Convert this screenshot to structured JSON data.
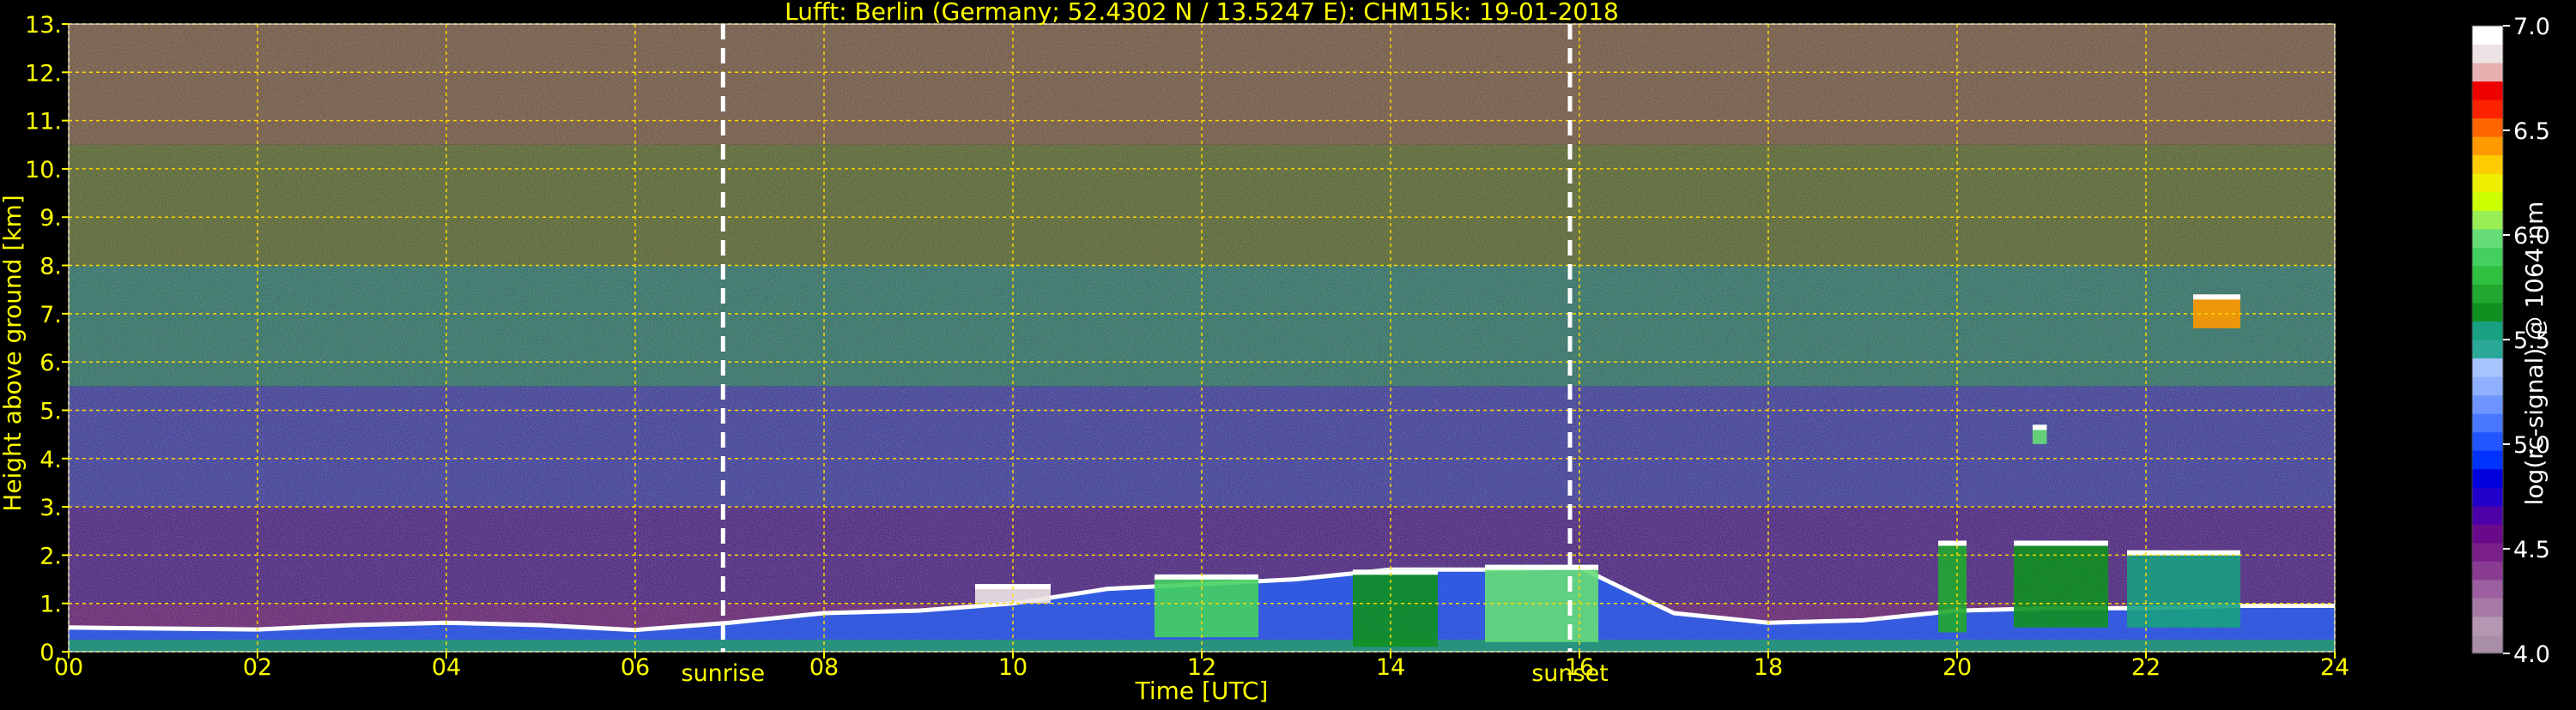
{
  "chart_data": {
    "type": "heatmap",
    "title": "Lufft: Berlin (Germany; 52.4302 N / 13.5247 E):    CHM15k: 19-01-2018",
    "xlabel": "Time [UTC]",
    "ylabel": "Height above ground [km]",
    "xlim": [
      0,
      24
    ],
    "ylim": [
      0,
      13
    ],
    "x_ticks": [
      0,
      2,
      4,
      6,
      8,
      10,
      12,
      14,
      16,
      18,
      20,
      22,
      24
    ],
    "x_tick_labels": [
      "00",
      "02",
      "04",
      "06",
      "08",
      "10",
      "12",
      "14",
      "16",
      "18",
      "20",
      "22",
      "24"
    ],
    "y_ticks": [
      0,
      1,
      2,
      3,
      4,
      5,
      6,
      7,
      8,
      9,
      10,
      11,
      12,
      13
    ],
    "y_tick_labels": [
      "0.",
      "1.",
      "2.",
      "3.",
      "4.",
      "5.",
      "6.",
      "7.",
      "8.",
      "9.",
      "10.",
      "11.",
      "12.",
      "13."
    ],
    "grid": true,
    "events": [
      {
        "label": "sunrise",
        "time": 6.93
      },
      {
        "label": "sunset",
        "time": 15.9
      }
    ],
    "colorbar": {
      "label": "log(rc-signal) @ 1064 nm",
      "range": [
        4.0,
        7.0
      ],
      "ticks": [
        4.0,
        4.5,
        5.0,
        5.5,
        6.0,
        6.5,
        7.0
      ],
      "tick_labels": [
        "4.0",
        "4.5",
        "5.0",
        "5.5",
        "6.0",
        "6.5",
        "7.0"
      ],
      "colors": [
        "#a98ea8",
        "#b498b2",
        "#a77aa6",
        "#9c5fa0",
        "#8a3c92",
        "#7a1e8a",
        "#6a0a8a",
        "#4b00a8",
        "#2200cc",
        "#0000dd",
        "#0033ff",
        "#2255ff",
        "#4a77ff",
        "#6e95ff",
        "#8fb0ff",
        "#a8c4ff",
        "#2aa898",
        "#18a080",
        "#109020",
        "#20a830",
        "#30c040",
        "#44d060",
        "#66dd77",
        "#99ee55",
        "#ccff00",
        "#eeee00",
        "#ffcc00",
        "#ff9900",
        "#ff6600",
        "#ff2200",
        "#ee0000",
        "#e8b0b0",
        "#ece4e4",
        "#ffffff"
      ]
    },
    "height_bands": [
      {
        "from_km": 0.0,
        "to_km": 1.0,
        "color": "#7a2a8a",
        "level": 5.0
      },
      {
        "from_km": 1.0,
        "to_km": 3.0,
        "color": "#5a2a9a",
        "level": 5.1
      },
      {
        "from_km": 3.0,
        "to_km": 5.5,
        "color": "#4a4ab8",
        "level": 5.4
      },
      {
        "from_km": 5.5,
        "to_km": 8.0,
        "color": "#3a8a7a",
        "level": 5.8
      },
      {
        "from_km": 8.0,
        "to_km": 10.5,
        "color": "#6a7a3a",
        "level": 6.1
      },
      {
        "from_km": 10.5,
        "to_km": 13.0,
        "color": "#8a6a50",
        "level": 6.3
      }
    ],
    "boundary_layer_km": [
      [
        0,
        0.5
      ],
      [
        1,
        0.48
      ],
      [
        2,
        0.46
      ],
      [
        3,
        0.55
      ],
      [
        4,
        0.6
      ],
      [
        5,
        0.55
      ],
      [
        6,
        0.45
      ],
      [
        7,
        0.6
      ],
      [
        8,
        0.8
      ],
      [
        9,
        0.85
      ],
      [
        10,
        1.0
      ],
      [
        11,
        1.3
      ],
      [
        12,
        1.4
      ],
      [
        13,
        1.5
      ],
      [
        14,
        1.7
      ],
      [
        15,
        1.7
      ],
      [
        16,
        1.75
      ],
      [
        17,
        0.8
      ],
      [
        18,
        0.6
      ],
      [
        19,
        0.65
      ],
      [
        20,
        0.85
      ],
      [
        21,
        0.9
      ],
      [
        22,
        0.9
      ],
      [
        23,
        0.95
      ],
      [
        24,
        0.95
      ]
    ],
    "cloud_features": [
      {
        "t0": 9.6,
        "t1": 10.4,
        "h0": 1.0,
        "h1": 1.4,
        "level": 6.9
      },
      {
        "t0": 11.5,
        "t1": 12.6,
        "h0": 0.3,
        "h1": 1.6,
        "level": 5.9
      },
      {
        "t0": 13.6,
        "t1": 14.5,
        "h0": 0.1,
        "h1": 1.7,
        "level": 5.6
      },
      {
        "t0": 15.0,
        "t1": 16.2,
        "h0": 0.2,
        "h1": 1.8,
        "level": 6.0
      },
      {
        "t0": 19.8,
        "t1": 20.1,
        "h0": 0.4,
        "h1": 2.3,
        "level": 5.7
      },
      {
        "t0": 20.6,
        "t1": 21.6,
        "h0": 0.5,
        "h1": 2.3,
        "level": 5.6
      },
      {
        "t0": 21.8,
        "t1": 23.0,
        "h0": 0.5,
        "h1": 2.1,
        "level": 5.5
      },
      {
        "t0": 22.5,
        "t1": 23.0,
        "h0": 6.7,
        "h1": 7.4,
        "level": 6.4
      },
      {
        "t0": 20.8,
        "t1": 20.95,
        "h0": 4.3,
        "h1": 4.7,
        "level": 6.0
      }
    ],
    "colors": {
      "background": "#000000",
      "axis_text": "#ffff00",
      "grid": "#ffd700",
      "event_line": "#ffffff",
      "colorbar_text": "#ffffff"
    }
  }
}
